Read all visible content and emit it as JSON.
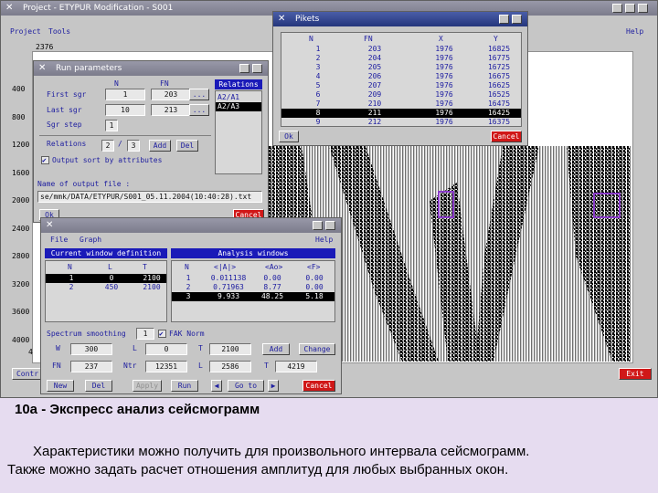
{
  "main_window": {
    "title": "Project - ETYPUR  Modification - S001",
    "menu": [
      "Project",
      "Tools"
    ],
    "help": "Help",
    "top_value": "2376",
    "depth_ticks": [
      "400",
      "800",
      "1200",
      "1600",
      "2000",
      "2400",
      "2800",
      "3200",
      "3600",
      "4000"
    ],
    "bottom_left_fragments": [
      "4",
      "Contr"
    ],
    "exit": "Exit"
  },
  "pikets": {
    "title": "Pikets",
    "headers": [
      "N",
      "FN",
      "X",
      "Y"
    ],
    "rows": [
      [
        "1",
        "203",
        "1976",
        "16825"
      ],
      [
        "2",
        "204",
        "1976",
        "16775"
      ],
      [
        "3",
        "205",
        "1976",
        "16725"
      ],
      [
        "4",
        "206",
        "1976",
        "16675"
      ],
      [
        "5",
        "207",
        "1976",
        "16625"
      ],
      [
        "6",
        "209",
        "1976",
        "16525"
      ],
      [
        "7",
        "210",
        "1976",
        "16475"
      ],
      [
        "8",
        "211",
        "1976",
        "16425"
      ],
      [
        "9",
        "212",
        "1976",
        "16375"
      ]
    ],
    "selected_row": 7,
    "ok": "Ok",
    "cancel": "Cancel"
  },
  "run": {
    "title": "Run parameters",
    "col_n": "N",
    "col_fn": "FN",
    "first_sgr": "First sgr",
    "last_sgr": "Last sgr",
    "sgr_step": "Sgr step",
    "first_n": "1",
    "first_fn": "203",
    "last_n": "10",
    "last_fn": "213",
    "step": "1",
    "relations": "Relations",
    "rel_a": "2",
    "rel_b": "3",
    "add": "Add",
    "del": "Del",
    "output_sort": "Output sort by attributes",
    "relations_hdr": "Relations",
    "rel_items": [
      "A2/A1",
      "A2/A3"
    ],
    "outname_label": "Name of output file :",
    "outname": "se/mmk/DATA/ETYPUR/S001_05.11.2004(10:40:28).txt",
    "ok": "Ok",
    "cancel": "Cancel"
  },
  "analysis": {
    "menu": [
      "File",
      "Graph"
    ],
    "help": "Help",
    "cwd_hdr": "Current window definition",
    "cwd_cols": [
      "N",
      "L",
      "T"
    ],
    "cwd_rows": [
      [
        "1",
        "0",
        "2100"
      ],
      [
        "2",
        "450",
        "2100"
      ]
    ],
    "aw_hdr": "Analysis windows",
    "aw_cols": [
      "N",
      "<|A|>",
      "<Ao>",
      "<F>"
    ],
    "aw_rows": [
      [
        "1",
        "0.011138",
        "0.00",
        "0.00"
      ],
      [
        "2",
        "0.71963",
        "8.77",
        "0.00"
      ],
      [
        "3",
        "9.933",
        "48.25",
        "5.18"
      ]
    ],
    "smoothing_label": "Spectrum smoothing",
    "smoothing": "1",
    "fak": "FAK Norm",
    "w_label": "W",
    "w": "300",
    "l_label": "L",
    "l": "0",
    "t_label": "T",
    "t": "2100",
    "add": "Add",
    "change": "Change",
    "fn_label": "FN",
    "fn": "237",
    "ntr_label": "Ntr",
    "ntr": "12351",
    "l2_label": "L",
    "l2": "2586",
    "t2_label": "T",
    "t2": "4219",
    "new": "New",
    "del": "Del",
    "apply": "Apply",
    "run": "Run",
    "goto": "Go to",
    "cancel": "Cancel"
  },
  "caption": {
    "heading": "10a - Экспресс анализ сейсмограмм",
    "line1": "Характеристики можно получить для произвольного интервала сейсмограмм.",
    "line2": "Также можно задать расчет отношения амплитуд для любых выбранных окон."
  }
}
